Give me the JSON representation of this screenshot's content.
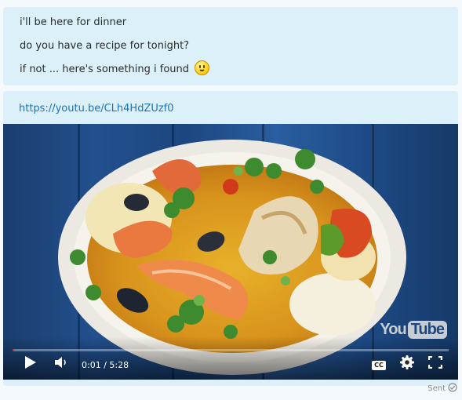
{
  "messages": {
    "lines": [
      "i'll be here for dinner",
      "do you have a recipe for tonight?",
      "if not ... here's something i found"
    ],
    "emoji_icon": "smiley-face-icon",
    "link": "https://youtu.be/CLh4HdZUzf0"
  },
  "video": {
    "current_time": "0:01",
    "duration": "5:28",
    "time_display": "0:01 / 5:28",
    "progress_fraction": 0.003,
    "logo_you": "You",
    "logo_tube": "Tube",
    "cc_label": "CC",
    "icons": [
      "play-icon",
      "volume-icon",
      "cc-icon",
      "settings-gear-icon",
      "fullscreen-icon"
    ],
    "progress_color": "#e62117"
  },
  "status": {
    "sent_label": "Sent",
    "sent_icon": "check-circle-icon"
  }
}
